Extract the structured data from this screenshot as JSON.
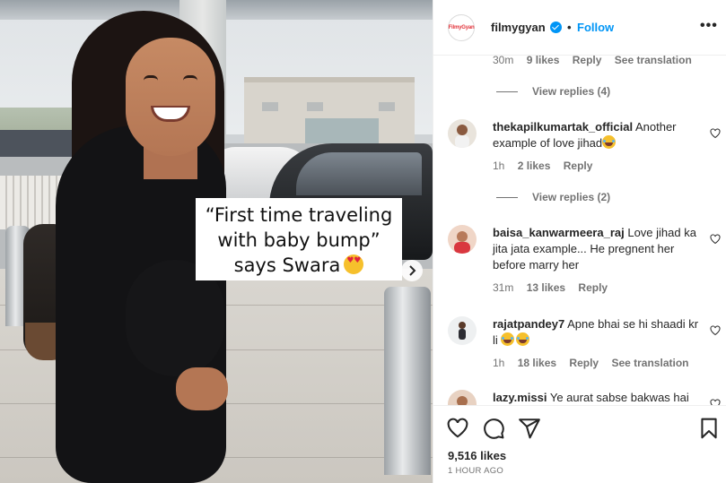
{
  "post": {
    "caption_line1": "“First time traveling",
    "caption_line2": "with baby bump”",
    "caption_line3": "says Swara"
  },
  "header": {
    "logo_text": "FilmyGyan",
    "username": "filmygyan",
    "separator": "•",
    "follow_label": "Follow",
    "more_label": "•••"
  },
  "comments": {
    "top_meta": {
      "time": "30m",
      "likes": "9 likes",
      "reply": "Reply",
      "translation": "See translation"
    },
    "view_replies_1": "View replies (4)",
    "items": [
      {
        "username": "thekapilkumartak_official",
        "text": "Another example of love jihad",
        "time": "1h",
        "likes": "2 likes",
        "reply": "Reply",
        "translation": ""
      },
      {
        "username": "baisa_kanwarmeera_raj",
        "text": "Love jihad ka jita jata example... He pregnent her before marry her",
        "time": "31m",
        "likes": "13 likes",
        "reply": "Reply",
        "translation": ""
      },
      {
        "username": "rajatpandey7",
        "text": "Apne bhai se hi shaadi kr li",
        "time": "1h",
        "likes": "18 likes",
        "reply": "Reply",
        "translation": "See translation"
      },
      {
        "username": "lazy.missi",
        "text": "Ye aurat sabse bakwas hai",
        "time": "",
        "likes": "",
        "reply": "",
        "translation": ""
      }
    ],
    "view_replies_2": "View replies (2)"
  },
  "actions": {
    "likes": "9,516 likes",
    "time": "1 HOUR AGO"
  },
  "colors": {
    "accent": "#0095f6",
    "secondary_text": "#737373",
    "primary_text": "#262626"
  }
}
